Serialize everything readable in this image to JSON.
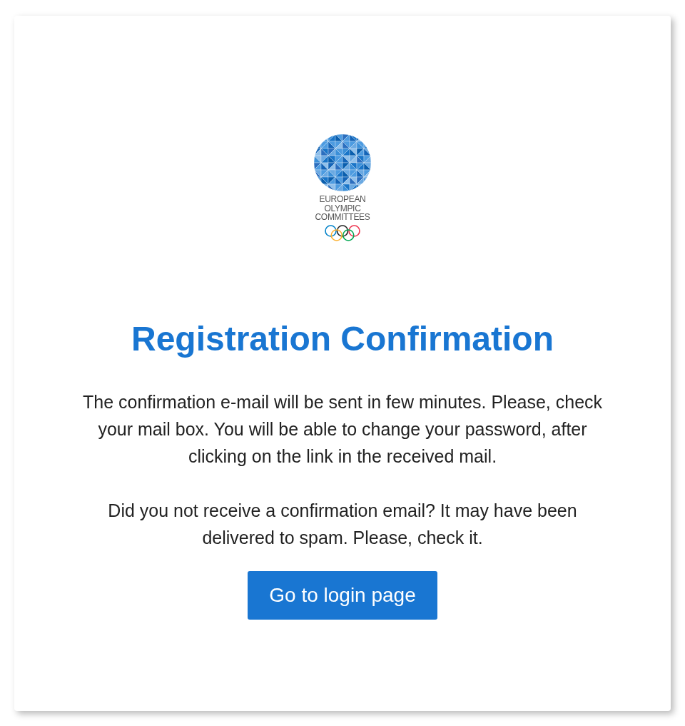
{
  "logo": {
    "lines": [
      "EUROPEAN",
      "OLYMPIC",
      "COMMITTEES"
    ]
  },
  "title": "Registration Confirmation",
  "paragraphs": [
    "The confirmation e-mail will be sent in few minutes. Please, check your mail box. You will be able to change your password, after clicking on the link in the received mail.",
    "Did you not receive a confirmation email? It may have been delivered to spam. Please, check it."
  ],
  "button": {
    "label": "Go to login page"
  }
}
